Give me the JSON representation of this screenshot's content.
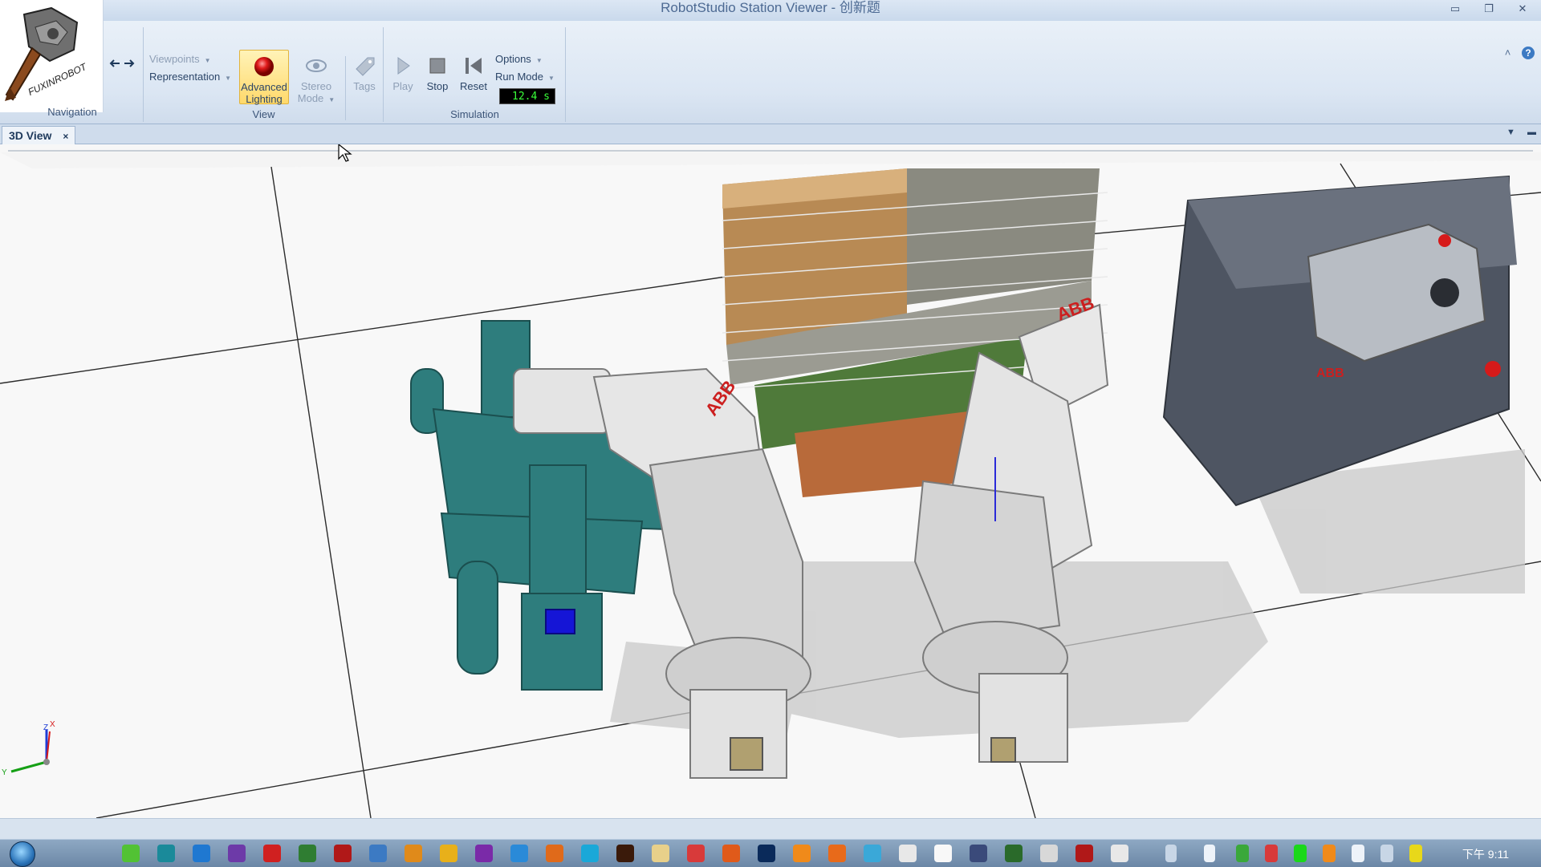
{
  "window": {
    "title": "RobotStudio Station Viewer - 创新题",
    "controls": {
      "minimize": "▭",
      "restore": "❐",
      "close": "✕"
    }
  },
  "logo": {
    "text": "FUXINROBOT"
  },
  "ribbon": {
    "help_up": "˄",
    "help": "?",
    "navigation": {
      "label": "Navigation",
      "back_icon": "arrow-left-icon",
      "forward_icon": "arrow-right-icon"
    },
    "view": {
      "label": "View",
      "viewpoints": "Viewpoints",
      "representation": "Representation",
      "advanced_lighting": [
        "Advanced",
        "Lighting"
      ],
      "stereo_mode": [
        "Stereo",
        "Mode"
      ],
      "tags": "Tags"
    },
    "simulation": {
      "label": "Simulation",
      "play": "Play",
      "stop": "Stop",
      "reset": "Reset",
      "options": "Options",
      "run_mode": "Run Mode",
      "time": "12.4 s"
    }
  },
  "tabs": [
    {
      "label": "3D View",
      "close": "×"
    }
  ],
  "viewport": {
    "axes": {
      "x": "X",
      "y": "Y",
      "z": "Z"
    }
  },
  "taskbar": {
    "clock": "下午 9:11"
  }
}
